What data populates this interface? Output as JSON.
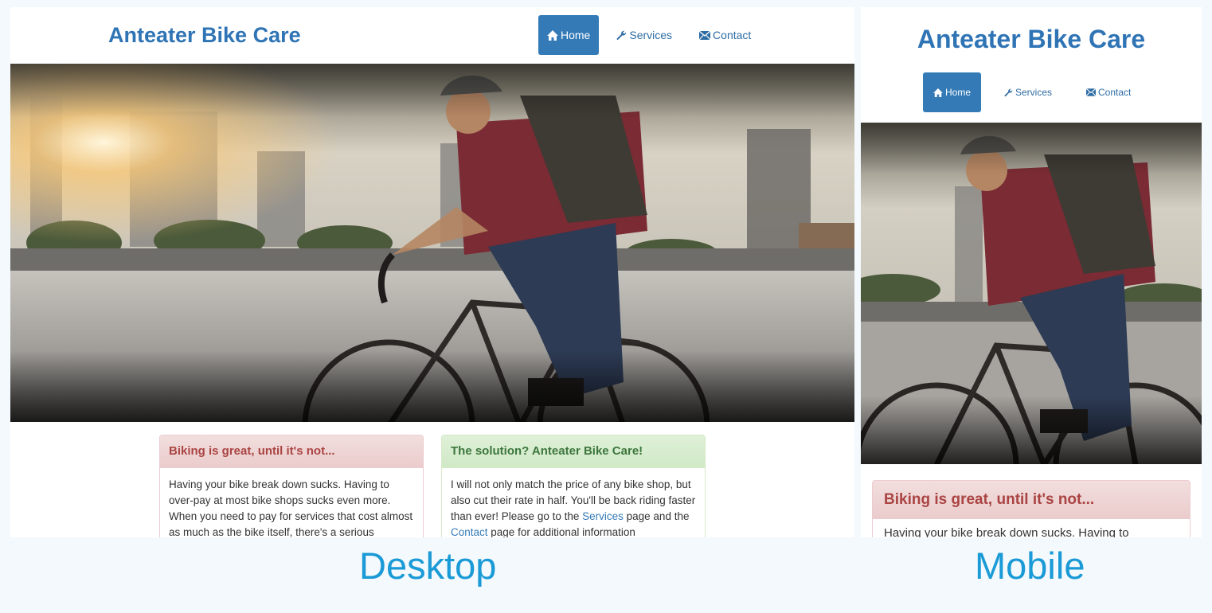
{
  "desktop": {
    "brand": "Anteater Bike Care",
    "nav": [
      {
        "label": "Home",
        "icon": "home-icon",
        "active": true
      },
      {
        "label": "Services",
        "icon": "wrench-icon",
        "active": false
      },
      {
        "label": "Contact",
        "icon": "envelope-icon",
        "active": false
      }
    ],
    "panels": [
      {
        "title": "Biking is great, until it's not...",
        "body": "Having your bike break down sucks. Having to over-pay at most bike shops sucks even more. When you need to pay for services that cost almost as much as the bike itself, there's a serious problem."
      },
      {
        "title": "The solution? Anteater Bike Care!",
        "body_before": "I will not only match the price of any bike shop, but also cut their rate in half. You'll be back riding faster than ever! Please go to the ",
        "link_services": "Services",
        "body_middle": " page and the ",
        "link_contact": "Contact",
        "body_after": " page for additional information"
      }
    ]
  },
  "mobile": {
    "brand": "Anteater Bike Care",
    "nav": [
      {
        "label": "Home",
        "icon": "home-icon",
        "active": true
      },
      {
        "label": "Services",
        "icon": "wrench-icon",
        "active": false
      },
      {
        "label": "Contact",
        "icon": "envelope-icon",
        "active": false
      }
    ],
    "panels": [
      {
        "title": "Biking is great, until it's not...",
        "body": "Having your bike break down sucks. Having to"
      }
    ]
  },
  "captions": {
    "desktop": "Desktop",
    "mobile": "Mobile"
  },
  "colors": {
    "brand": "#2f74b5",
    "nav_active": "#337ab7",
    "danger_text": "#a94442",
    "success_text": "#3c763d",
    "caption": "#1a9ad6"
  }
}
